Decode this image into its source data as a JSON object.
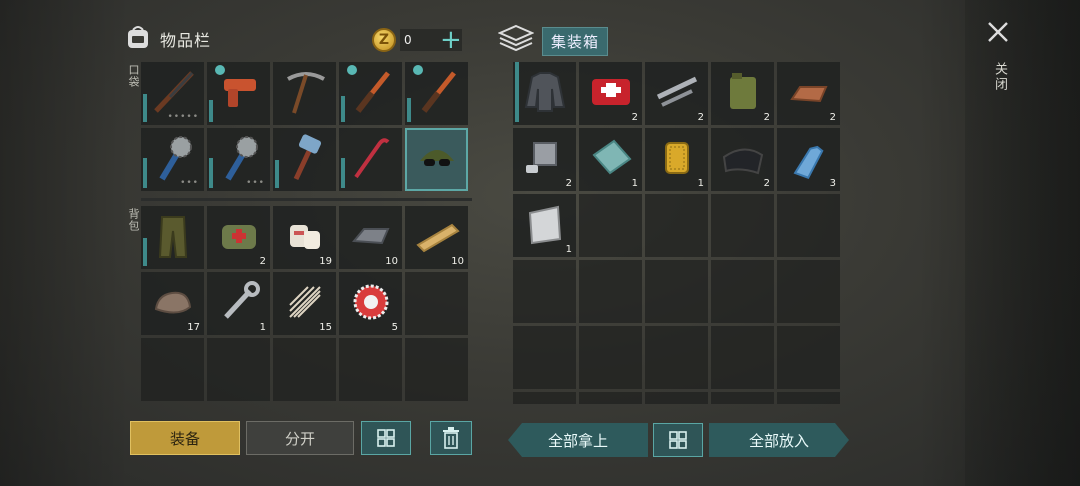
{
  "inventory": {
    "title": "物品栏",
    "coins": "0",
    "pocket_label": "口袋",
    "backpack_label": "背包",
    "pocket_items": [
      {
        "name": "shotgun-icon",
        "count": "",
        "dots": "•••••",
        "badge": false,
        "bar": 28
      },
      {
        "name": "flare-gun-icon",
        "count": "",
        "dots": "",
        "badge": true,
        "bar": 22
      },
      {
        "name": "pickaxe-icon",
        "count": "",
        "dots": "",
        "badge": false,
        "bar": 0
      },
      {
        "name": "knife-icon",
        "count": "",
        "dots": "",
        "badge": true,
        "bar": 26
      },
      {
        "name": "knife-icon",
        "count": "",
        "dots": "",
        "badge": true,
        "bar": 24
      },
      {
        "name": "spiked-club-icon",
        "count": "",
        "dots": "•••",
        "badge": false,
        "bar": 30
      },
      {
        "name": "spiked-club-icon",
        "count": "",
        "dots": "•••",
        "badge": false,
        "bar": 30
      },
      {
        "name": "sledgehammer-icon",
        "count": "",
        "dots": "",
        "badge": false,
        "bar": 28
      },
      {
        "name": "crowbar-icon",
        "count": "",
        "dots": "",
        "badge": false,
        "bar": 30
      },
      {
        "name": "sunglasses-cap-icon",
        "count": "",
        "dots": "",
        "badge": false,
        "bar": 0,
        "selected": true
      }
    ],
    "backpack_items": [
      {
        "name": "camo-pants-icon",
        "count": "",
        "bar": 28
      },
      {
        "name": "medic-bag-icon",
        "count": "2"
      },
      {
        "name": "bandage-icon",
        "count": "19"
      },
      {
        "name": "metal-ingot-icon",
        "count": "10"
      },
      {
        "name": "wood-plank-icon",
        "count": "10"
      },
      {
        "name": "rock-icon",
        "count": "17"
      },
      {
        "name": "wrench-icon",
        "count": "1"
      },
      {
        "name": "plant-fiber-icon",
        "count": "15"
      },
      {
        "name": "bottle-cap-icon",
        "count": "5"
      },
      {
        "name": "empty",
        "count": ""
      },
      {
        "name": "empty",
        "count": ""
      },
      {
        "name": "empty",
        "count": ""
      },
      {
        "name": "empty",
        "count": ""
      },
      {
        "name": "empty",
        "count": ""
      },
      {
        "name": "empty",
        "count": ""
      }
    ]
  },
  "container": {
    "title": "集装箱",
    "items": [
      {
        "name": "armored-jacket-icon",
        "count": "",
        "bar": 60
      },
      {
        "name": "first-aid-kit-icon",
        "count": "2"
      },
      {
        "name": "metal-pipes-icon",
        "count": "2"
      },
      {
        "name": "jerry-can-icon",
        "count": "2"
      },
      {
        "name": "copper-ingot-icon",
        "count": "2"
      },
      {
        "name": "engine-parts-icon",
        "count": "2"
      },
      {
        "name": "glass-icon",
        "count": "1"
      },
      {
        "name": "oil-filter-icon",
        "count": "1"
      },
      {
        "name": "black-cloth-icon",
        "count": "2"
      },
      {
        "name": "water-bottle-icon",
        "count": "3"
      },
      {
        "name": "aluminum-sheet-icon",
        "count": "1"
      }
    ],
    "empty_slots": 19
  },
  "buttons": {
    "equip": "装备",
    "split": "分开",
    "take_all": "全部拿上",
    "put_all": "全部放入"
  },
  "close_label": "关闭",
  "colors": {
    "accent": "#5aa6a4",
    "equip": "#bf9a3a",
    "gold": "#e0b63c"
  }
}
